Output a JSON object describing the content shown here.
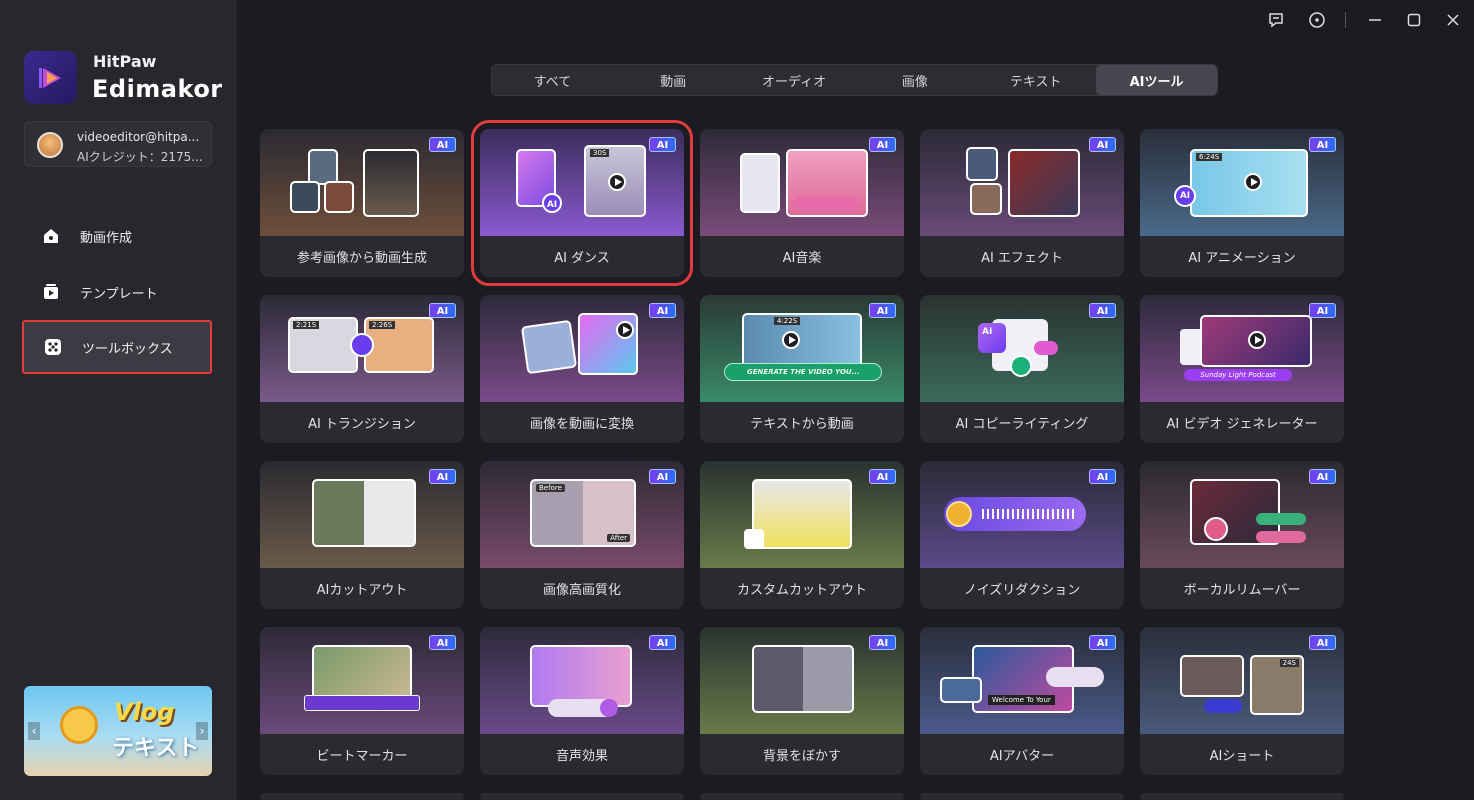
{
  "app": {
    "brand_line1": "HitPaw",
    "brand_line2": "Edimakor"
  },
  "account": {
    "email": "videoeditor@hitpa...",
    "credits": "AIクレジット：2175..."
  },
  "sidebar": {
    "items": [
      {
        "label": "動画作成",
        "icon": "video-create-icon",
        "active": false
      },
      {
        "label": "テンプレート",
        "icon": "template-icon",
        "active": false
      },
      {
        "label": "ツールボックス",
        "icon": "toolbox-icon",
        "active": true
      }
    ]
  },
  "promo": {
    "title": "Vlog",
    "subtitle": "テキスト"
  },
  "tabs": [
    {
      "label": "すべて",
      "active": false
    },
    {
      "label": "動画",
      "active": false
    },
    {
      "label": "オーディオ",
      "active": false
    },
    {
      "label": "画像",
      "active": false
    },
    {
      "label": "テキスト",
      "active": false
    },
    {
      "label": "AIツール",
      "active": true
    }
  ],
  "badge_text": "AI",
  "tools": [
    {
      "label": "参考画像から動画生成",
      "highlighted": false
    },
    {
      "label": "AI ダンス",
      "highlighted": true
    },
    {
      "label": "AI音楽",
      "highlighted": false
    },
    {
      "label": "AI エフェクト",
      "highlighted": false
    },
    {
      "label": "AI アニメーション",
      "highlighted": false
    },
    {
      "label": "AI トランジション",
      "highlighted": false
    },
    {
      "label": "画像を動画に変換",
      "highlighted": false
    },
    {
      "label": "テキストから動画",
      "highlighted": false
    },
    {
      "label": "AI コピーライティング",
      "highlighted": false
    },
    {
      "label": "AI ビデオ ジェネレーター",
      "highlighted": false
    },
    {
      "label": "AIカットアウト",
      "highlighted": false
    },
    {
      "label": "画像高画質化",
      "highlighted": false
    },
    {
      "label": "カスタムカットアウト",
      "highlighted": false
    },
    {
      "label": "ノイズリダクション",
      "highlighted": false
    },
    {
      "label": "ボーカルリムーバー",
      "highlighted": false
    },
    {
      "label": "ビートマーカー",
      "highlighted": false
    },
    {
      "label": "音声効果",
      "highlighted": false
    },
    {
      "label": "背景をぼかす",
      "highlighted": false
    },
    {
      "label": "AIアバター",
      "highlighted": false
    },
    {
      "label": "AIショート",
      "highlighted": false
    }
  ],
  "thumb_texts": {
    "dance_time": "30S",
    "anim_time": "6:24S",
    "trans_t1": "2:21S",
    "trans_t2": "2:26S",
    "t2v_time": "4:22S",
    "t2v_prompt": "GENERATE THE VIDEO YOU...",
    "podcast": "Sunday Light Podcast",
    "before": "Before",
    "after": "After",
    "welcome": "Welcome To Your",
    "short_time": "24S"
  },
  "colors": {
    "accent": "#7a3cf0",
    "highlight": "#e03c3c",
    "sidebar_bg": "#28272d",
    "main_bg": "#1c1b22"
  }
}
